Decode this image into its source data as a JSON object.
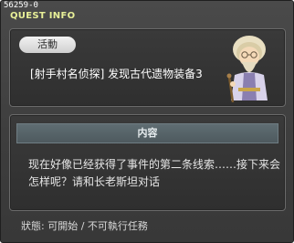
{
  "window": {
    "quest_id": "56259-0",
    "title": "QUEST INFO"
  },
  "quest": {
    "tag_label": "活動",
    "name": "[射手村名侦探] 发现古代遗物装备3",
    "npc": "elder-npc-portrait"
  },
  "details": {
    "header": "内容",
    "description": "现在好像已经获得了事件的第二条线索……接下来会怎样呢？请和长老斯坦对话"
  },
  "footer": {
    "status": "狀態:  可開始 / 不可執行任務"
  },
  "colors": {
    "title": "#e8f098",
    "window_bg": "#3d3d3d",
    "header_bg": "#56646a"
  }
}
